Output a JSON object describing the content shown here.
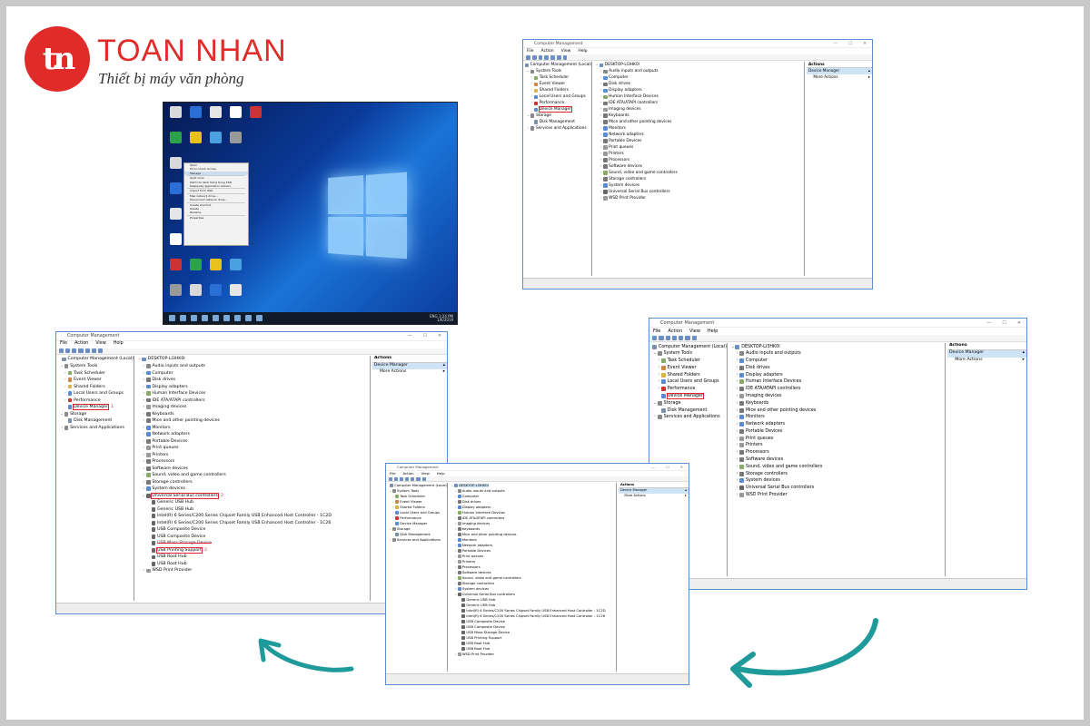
{
  "brand": {
    "mark": "tn",
    "name": "TOAN NHAN",
    "tagline": "Thiết bị máy văn phòng",
    "color": "#e02b28"
  },
  "steps": [
    "1",
    "2",
    "3"
  ],
  "desktop": {
    "context_menu": [
      "Open",
      "Pin to Quick access",
      "Manage",
      "",
      "Quét virus",
      "Kiểm tra danh tiếng trong KSN",
      "Kaspersky Application Advisor",
      "",
      "Import from Web",
      "",
      "Map network drive...",
      "Disconnect network drive...",
      "",
      "Create shortcut",
      "Delete",
      "Rename",
      "",
      "Properties"
    ],
    "tray_time": "1:24 PM",
    "tray_date": "1/6/2019",
    "tray_lang": "ENG"
  },
  "cm": {
    "title": "Computer Management",
    "controls": [
      "—",
      "☐",
      "✕"
    ],
    "menu": [
      "File",
      "Action",
      "View",
      "Help"
    ],
    "tree_root": "Computer Management (Local)",
    "system_tools": "System Tools",
    "tree": [
      "Task Scheduler",
      "Event Viewer",
      "Shared Folders",
      "Local Users and Groups",
      "Performance",
      "Device Manager"
    ],
    "storage": "Storage",
    "disk_mgmt": "Disk Management",
    "services": "Services and Applications",
    "computer_name": "DESKTOP-LI3HK0I",
    "devices": [
      "Audio inputs and outputs",
      "Computer",
      "Disk drives",
      "Display adapters",
      "Human Interface Devices",
      "IDE ATA/ATAPI controllers",
      "Imaging devices",
      "Keyboards",
      "Mice and other pointing devices",
      "Monitors",
      "Network adapters",
      "Portable Devices",
      "Print queues",
      "Printers",
      "Processors",
      "Software devices",
      "Sound, video and game controllers",
      "Storage controllers",
      "System devices",
      "Universal Serial Bus controllers",
      "WSD Print Provider"
    ],
    "usb_children": [
      "Generic USB Hub",
      "Generic USB Hub",
      "Intel(R) 6 Series/C200 Series Chipset Family USB Enhanced Host Controller - 1C2D",
      "Intel(R) 6 Series/C200 Series Chipset Family USB Enhanced Host Controller - 1C26",
      "USB Composite Device",
      "USB Composite Device",
      "USB Mass Storage Device",
      "USB Printing Support",
      "USB Root Hub",
      "USB Root Hub"
    ],
    "actions_title": "Actions",
    "actions_item": "Device Manager",
    "actions_more": "More Actions"
  },
  "annotations": {
    "n1": "1",
    "n2": "2",
    "n3": "3"
  },
  "colors": {
    "step": "#80c6ab",
    "arrow": "#1e9a9a",
    "highlight": "#e0262d"
  }
}
